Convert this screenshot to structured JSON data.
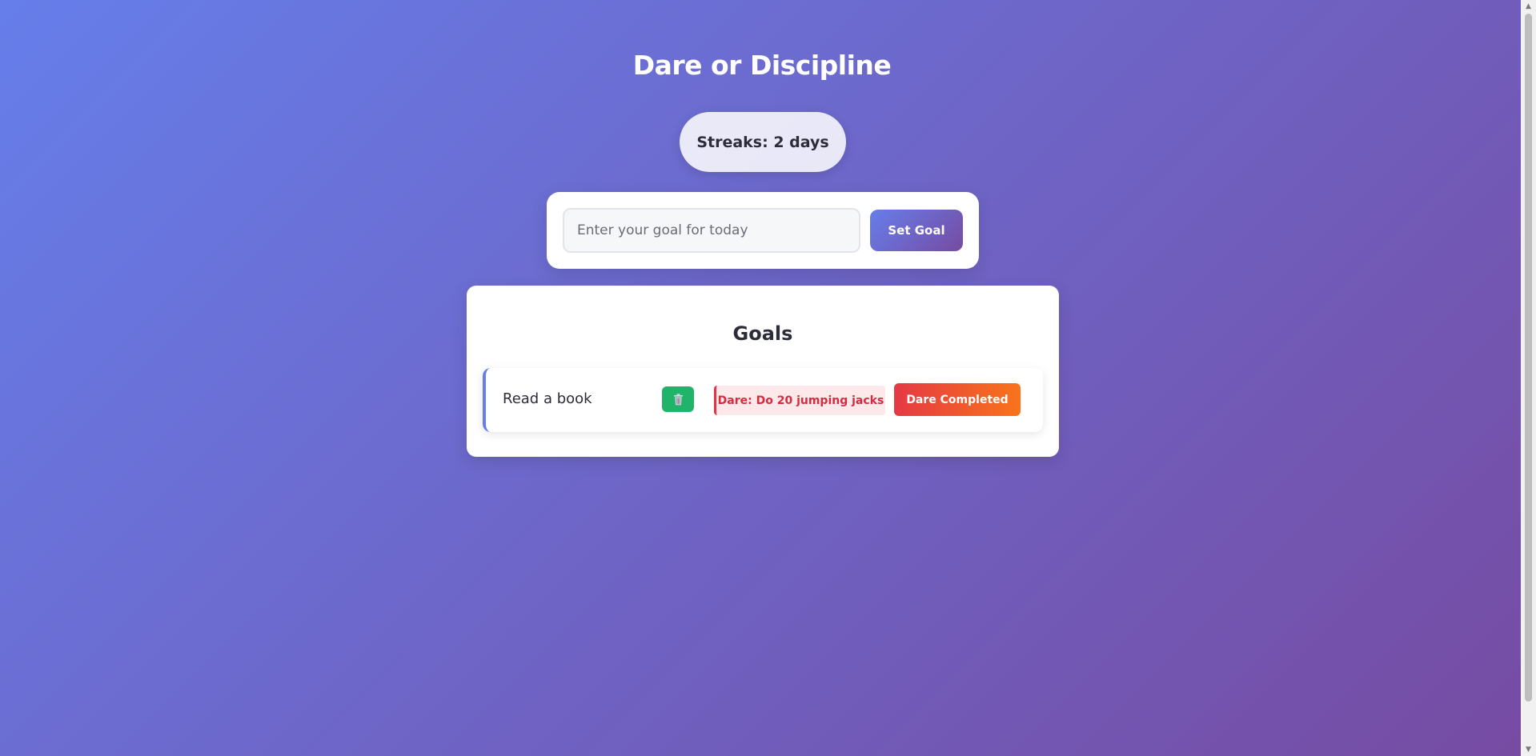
{
  "app": {
    "title": "Dare or Discipline",
    "streak_label": "Streaks: 2 days"
  },
  "goal_form": {
    "input_placeholder": "Enter your goal for today",
    "input_value": "",
    "submit_label": "Set Goal"
  },
  "goals_panel": {
    "heading": "Goals",
    "items": [
      {
        "text": "Read a book",
        "delete_icon": "trash-icon",
        "dare_label": "Dare: Do 20 jumping jacks",
        "dare_button_label": "Dare Completed"
      }
    ]
  },
  "colors": {
    "gradient_start": "#667eea",
    "gradient_end": "#764ba2",
    "delete_green": "#1fb46a",
    "dare_red": "#e03447",
    "dare_orange": "#f8741a"
  }
}
